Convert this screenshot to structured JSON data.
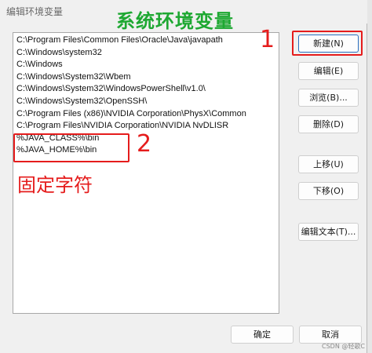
{
  "window": {
    "title": "编辑环境变量"
  },
  "annotations": {
    "title": "系统环境变量",
    "num_1": "1",
    "num_2": "2",
    "fixed_chars": "固定字符"
  },
  "path_list": [
    "C:\\Program Files\\Common Files\\Oracle\\Java\\javapath",
    "C:\\Windows\\system32",
    "C:\\Windows",
    "C:\\Windows\\System32\\Wbem",
    "C:\\Windows\\System32\\WindowsPowerShell\\v1.0\\",
    "C:\\Windows\\System32\\OpenSSH\\",
    "C:\\Program Files (x86)\\NVIDIA Corporation\\PhysX\\Common",
    "C:\\Program Files\\NVIDIA Corporation\\NVIDIA NvDLISR",
    "%JAVA_CLASS%\\bin",
    "%JAVA_HOME%\\bin"
  ],
  "buttons": {
    "new": "新建(N)",
    "edit": "编辑(E)",
    "browse": "浏览(B)...",
    "delete": "删除(D)",
    "move_up": "上移(U)",
    "move_down": "下移(O)",
    "edit_text": "编辑文本(T)...",
    "ok": "确定",
    "cancel": "取消"
  },
  "watermark": "CSDN @轻歌C",
  "colors": {
    "annotation_red": "#e51c1c",
    "annotation_green": "#1ea832",
    "default_button_border": "#2b6fbf"
  }
}
